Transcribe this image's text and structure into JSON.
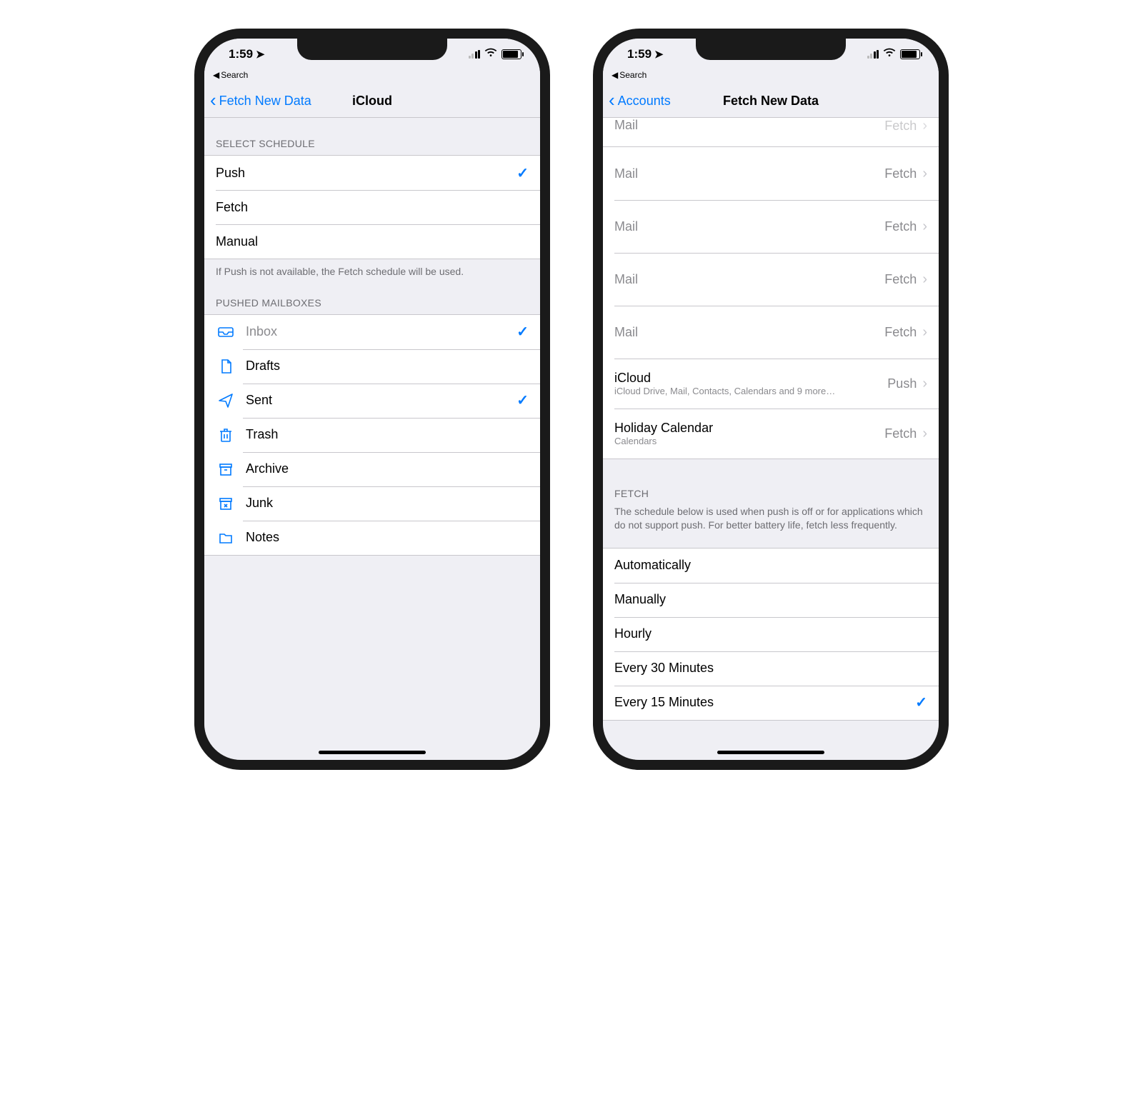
{
  "status": {
    "time": "1:59",
    "back_app": "Search"
  },
  "left": {
    "nav_back": "Fetch New Data",
    "nav_title": "iCloud",
    "schedule_header": "SELECT SCHEDULE",
    "schedule": [
      {
        "label": "Push",
        "checked": true
      },
      {
        "label": "Fetch",
        "checked": false
      },
      {
        "label": "Manual",
        "checked": false
      }
    ],
    "schedule_footer": "If Push is not available, the Fetch schedule will be used.",
    "mailboxes_header": "PUSHED MAILBOXES",
    "mailboxes": [
      {
        "icon": "inbox",
        "label": "Inbox",
        "checked": true,
        "dim": true
      },
      {
        "icon": "drafts",
        "label": "Drafts",
        "checked": false,
        "dim": false
      },
      {
        "icon": "sent",
        "label": "Sent",
        "checked": true,
        "dim": false
      },
      {
        "icon": "trash",
        "label": "Trash",
        "checked": false,
        "dim": false
      },
      {
        "icon": "archive",
        "label": "Archive",
        "checked": false,
        "dim": false
      },
      {
        "icon": "junk",
        "label": "Junk",
        "checked": false,
        "dim": false
      },
      {
        "icon": "notes-folder",
        "label": "Notes",
        "checked": false,
        "dim": false
      }
    ]
  },
  "right": {
    "nav_back": "Accounts",
    "nav_title": "Fetch New Data",
    "partial_top": {
      "label": "Mail",
      "detail": "Fetch"
    },
    "accounts": [
      {
        "label": "Mail",
        "sub": "",
        "detail": "Fetch"
      },
      {
        "label": "Mail",
        "sub": "",
        "detail": "Fetch"
      },
      {
        "label": "Mail",
        "sub": "",
        "detail": "Fetch"
      },
      {
        "label": "Mail",
        "sub": "",
        "detail": "Fetch"
      },
      {
        "label": "iCloud",
        "sub": "iCloud Drive, Mail, Contacts, Calendars and 9 more…",
        "detail": "Push"
      },
      {
        "label": "Holiday Calendar",
        "sub": "Calendars",
        "detail": "Fetch"
      }
    ],
    "fetch_header": "FETCH",
    "fetch_footer": "The schedule below is used when push is off or for applications which do not support push. For better battery life, fetch less frequently.",
    "fetch_options": [
      {
        "label": "Automatically",
        "checked": false
      },
      {
        "label": "Manually",
        "checked": false
      },
      {
        "label": "Hourly",
        "checked": false
      },
      {
        "label": "Every 30 Minutes",
        "checked": false
      },
      {
        "label": "Every 15 Minutes",
        "checked": true
      }
    ]
  }
}
